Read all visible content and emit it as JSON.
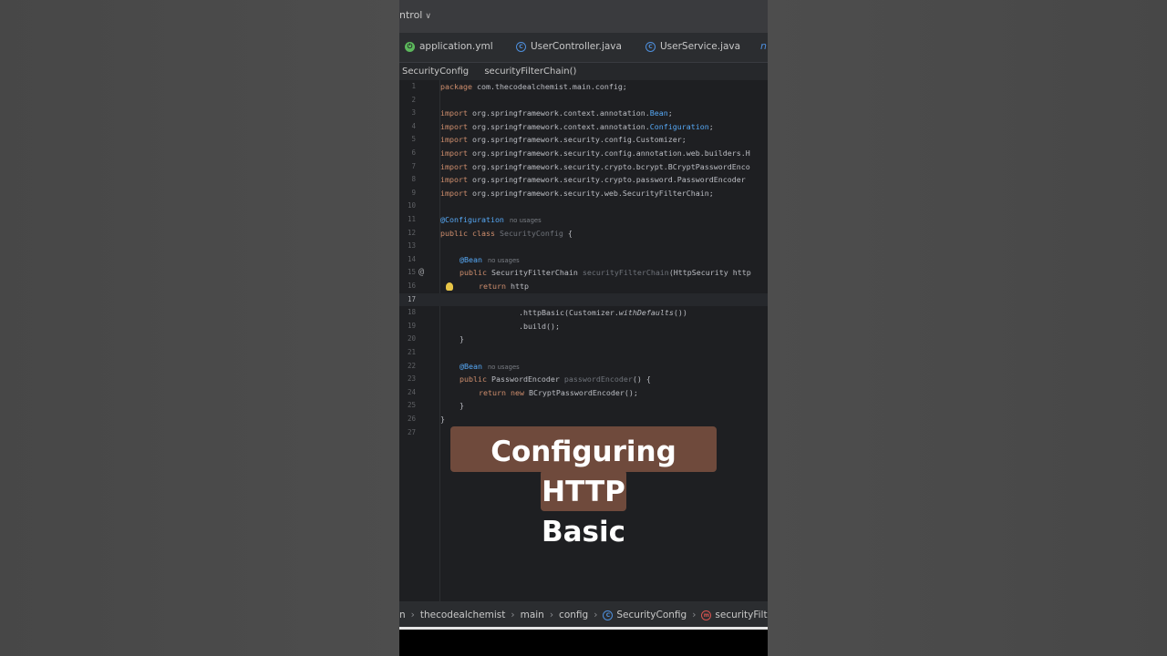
{
  "window": {
    "project_label": "ntrol",
    "project_chevron": "∨"
  },
  "tabs": [
    {
      "label": "application.yml",
      "icon": "spring-boot-icon"
    },
    {
      "label": "UserController.java",
      "icon": "class-icon"
    },
    {
      "label": "UserService.java",
      "icon": "class-icon"
    }
  ],
  "tab_overflow": "n",
  "breadcrumbs": [
    "SecurityConfig",
    "securityFilterChain()"
  ],
  "code_lines": [
    {
      "n": "1"
    },
    {
      "n": "2"
    },
    {
      "n": "3"
    },
    {
      "n": "4"
    },
    {
      "n": "5"
    },
    {
      "n": "6"
    },
    {
      "n": "7"
    },
    {
      "n": "8"
    },
    {
      "n": "9"
    },
    {
      "n": "10"
    },
    {
      "n": "11"
    },
    {
      "n": "12"
    },
    {
      "n": "13"
    },
    {
      "n": "14"
    },
    {
      "n": "15"
    },
    {
      "n": "16"
    },
    {
      "n": "17"
    },
    {
      "n": "18"
    },
    {
      "n": "19"
    },
    {
      "n": "20"
    },
    {
      "n": "21"
    },
    {
      "n": "22"
    },
    {
      "n": "23"
    },
    {
      "n": "24"
    },
    {
      "n": "25"
    },
    {
      "n": "26"
    },
    {
      "n": "27"
    }
  ],
  "code": {
    "l1a": "package",
    "l1b": " com.thecodealchemist.main.config;",
    "l3a": "import",
    "l3b": " org.springframework.context.annotation.",
    "l3c": "Bean",
    "l3d": ";",
    "l4a": "import",
    "l4b": " org.springframework.context.annotation.",
    "l4c": "Configuration",
    "l4d": ";",
    "l5a": "import",
    "l5b": " org.springframework.security.config.Customizer;",
    "l6a": "import",
    "l6b": " org.springframework.security.config.annotation.web.builders.H",
    "l7a": "import",
    "l7b": " org.springframework.security.crypto.bcrypt.BCryptPasswordEnco",
    "l8a": "import",
    "l8b": " org.springframework.security.crypto.password.PasswordEncoder",
    "l9a": "import",
    "l9b": " org.springframework.security.web.SecurityFilterChain;",
    "l11a": "@Configuration",
    "l11h": "no usages",
    "l12a": "public class",
    "l12b": " SecurityConfig",
    "l12c": " {",
    "l14a": "@Bean",
    "l14h": "no usages",
    "l15a": "public",
    "l15b": " SecurityFilterChain ",
    "l15c": "securityFilterChain",
    "l15d": "(HttpSecurity http",
    "l16a": "return",
    "l16b": " http",
    "l18a": ".httpBasic(Customizer.",
    "l18b": "withDefaults",
    "l18c": "())",
    "l19a": ".build();",
    "l20a": "}",
    "l22a": "@Bean",
    "l22h": "no usages",
    "l23a": "public",
    "l23b": " PasswordEncoder ",
    "l23c": "passwordEncoder",
    "l23d": "() {",
    "l24a": "return new",
    "l24b": " BCryptPasswordEncoder();",
    "l25a": "}",
    "l26a": "}"
  },
  "gutter": {
    "at_icon": "@"
  },
  "status_path": [
    "n",
    "thecodealchemist",
    "main",
    "config",
    "SecurityConfig",
    "securityFilterCh"
  ],
  "caption": {
    "line1": "Configuring HTTP",
    "line2": "Basic"
  },
  "colors": {
    "caption_bg": "#6f4a3c",
    "editor_bg": "#1e1f22",
    "keyword": "#cf8e6d",
    "annotation": "#b3ae60"
  }
}
